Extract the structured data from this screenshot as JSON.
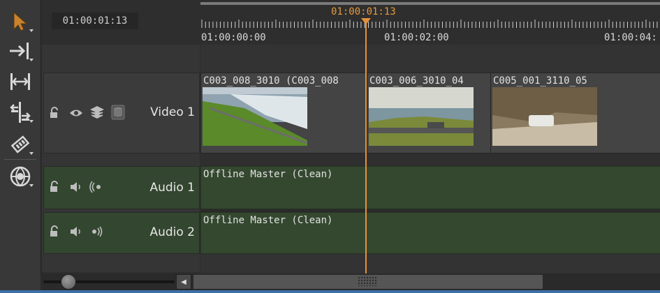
{
  "timecode": "01:00:01:13",
  "playhead_label": "01:00:01:13",
  "ruler_labels": [
    "01:00:00:00",
    "01:00:02:00",
    "01:00:04:"
  ],
  "tools": [
    {
      "name": "select-tool-icon"
    },
    {
      "name": "track-select-forward-icon"
    },
    {
      "name": "range-icon"
    },
    {
      "name": "slip-icon"
    },
    {
      "name": "razor-icon"
    },
    {
      "name": "globe-menu-icon"
    }
  ],
  "tracks": {
    "video1": {
      "label": "Video 1"
    },
    "audio1": {
      "label": "Audio 1"
    },
    "audio2": {
      "label": "Audio 2"
    }
  },
  "clips": {
    "v1": "C003_008_3010 (C003_008",
    "v2": "C003_006_3010_04",
    "v3": "C005_001_3110_05",
    "a1": "Offline Master (Clean)",
    "a2": "Offline Master (Clean)"
  },
  "colors": {
    "playhead": "#e5913a",
    "audio_clip": "#34482f"
  }
}
